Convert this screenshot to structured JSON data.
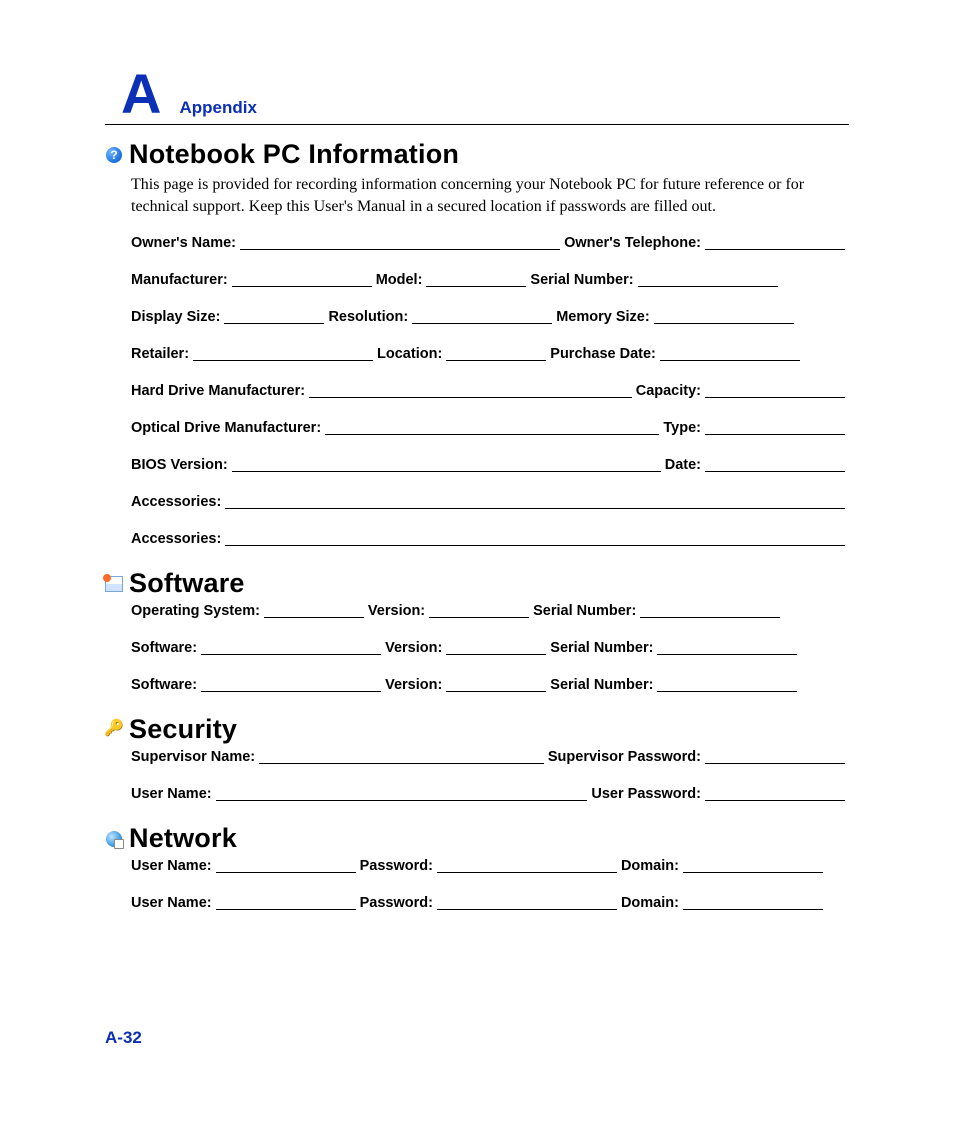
{
  "header": {
    "letter": "A",
    "label": "Appendix"
  },
  "pageNumber": "A-32",
  "notebook": {
    "title": "Notebook PC Information",
    "intro": "This page is provided for recording information concerning your Notebook PC for future reference or for technical support. Keep this User's Manual in a secured location if passwords are filled out.",
    "rows": [
      [
        {
          "label": "Owner's Name:",
          "fill": "grow"
        },
        {
          "label": "Owner's Telephone:",
          "fill": "med"
        }
      ],
      [
        {
          "label": "Manufacturer:",
          "fill": "med"
        },
        {
          "label": "Model:",
          "fill": "short"
        },
        {
          "label": "Serial Number:",
          "fill": "med"
        }
      ],
      [
        {
          "label": "Display Size:",
          "fill": "short"
        },
        {
          "label": "Resolution:",
          "fill": "med"
        },
        {
          "label": "Memory Size:",
          "fill": "med"
        }
      ],
      [
        {
          "label": "Retailer:",
          "fill": "mlong"
        },
        {
          "label": "Location:",
          "fill": "short"
        },
        {
          "label": "Purchase Date:",
          "fill": "med"
        }
      ],
      [
        {
          "label": "Hard Drive Manufacturer:",
          "fill": "grow"
        },
        {
          "label": "Capacity:",
          "fill": "med"
        }
      ],
      [
        {
          "label": "Optical Drive Manufacturer:",
          "fill": "grow"
        },
        {
          "label": "Type:",
          "fill": "med"
        }
      ],
      [
        {
          "label": "BIOS Version:",
          "fill": "grow"
        },
        {
          "label": "Date:",
          "fill": "med"
        }
      ],
      [
        {
          "label": "Accessories:",
          "fill": "grow"
        }
      ],
      [
        {
          "label": "Accessories:",
          "fill": "grow"
        }
      ]
    ]
  },
  "software": {
    "title": "Software",
    "rows": [
      [
        {
          "label": "Operating System:",
          "fill": "short"
        },
        {
          "label": "Version:",
          "fill": "short"
        },
        {
          "label": "Serial Number:",
          "fill": "med"
        }
      ],
      [
        {
          "label": "Software:",
          "fill": "mlong"
        },
        {
          "label": "Version:",
          "fill": "short"
        },
        {
          "label": "Serial Number:",
          "fill": "med"
        }
      ],
      [
        {
          "label": "Software:",
          "fill": "mlong"
        },
        {
          "label": "Version:",
          "fill": "short"
        },
        {
          "label": "Serial Number:",
          "fill": "med"
        }
      ]
    ]
  },
  "security": {
    "title": "Security",
    "rows": [
      [
        {
          "label": "Supervisor Name:",
          "fill": "grow"
        },
        {
          "label": "Supervisor Password:",
          "fill": "med"
        }
      ],
      [
        {
          "label": "User Name:",
          "fill": "grow"
        },
        {
          "label": "User Password:",
          "fill": "med"
        }
      ]
    ]
  },
  "network": {
    "title": "Network",
    "rows": [
      [
        {
          "label": "User Name:",
          "fill": "med"
        },
        {
          "label": "Password:",
          "fill": "mlong"
        },
        {
          "label": "Domain:",
          "fill": "med"
        }
      ],
      [
        {
          "label": "User Name:",
          "fill": "med"
        },
        {
          "label": "Password:",
          "fill": "mlong"
        },
        {
          "label": "Domain:",
          "fill": "med"
        }
      ]
    ]
  }
}
